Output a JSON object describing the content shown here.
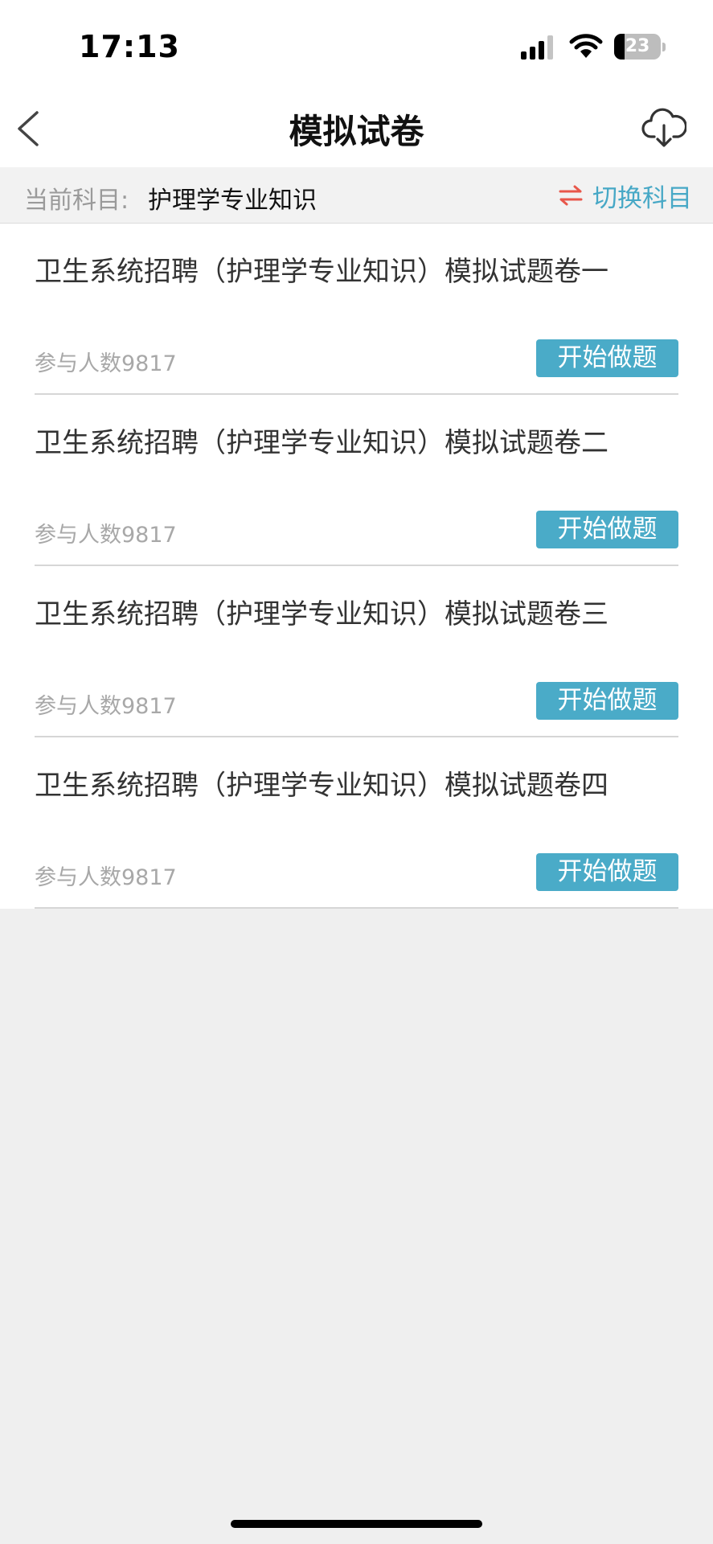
{
  "status_bar": {
    "time": "17:13",
    "battery_level": "23",
    "battery_fraction": 0.23
  },
  "nav": {
    "title": "模拟试卷",
    "back_icon": "chevron-left-icon",
    "download_icon": "cloud-download-icon"
  },
  "subject": {
    "label": "当前科目:",
    "value": "护理学专业知识",
    "switch_label": "切换科目",
    "switch_icon": "swap-arrows-icon",
    "switch_icon_color": "#e8574b",
    "accent_color": "#47a8c6"
  },
  "papers": [
    {
      "title": "卫生系统招聘（护理学专业知识）模拟试题卷一",
      "count": "参与人数9817",
      "button": "开始做题"
    },
    {
      "title": "卫生系统招聘（护理学专业知识）模拟试题卷二",
      "count": "参与人数9817",
      "button": "开始做题"
    },
    {
      "title": "卫生系统招聘（护理学专业知识）模拟试题卷三",
      "count": "参与人数9817",
      "button": "开始做题"
    },
    {
      "title": "卫生系统招聘（护理学专业知识）模拟试题卷四",
      "count": "参与人数9817",
      "button": "开始做题"
    }
  ]
}
